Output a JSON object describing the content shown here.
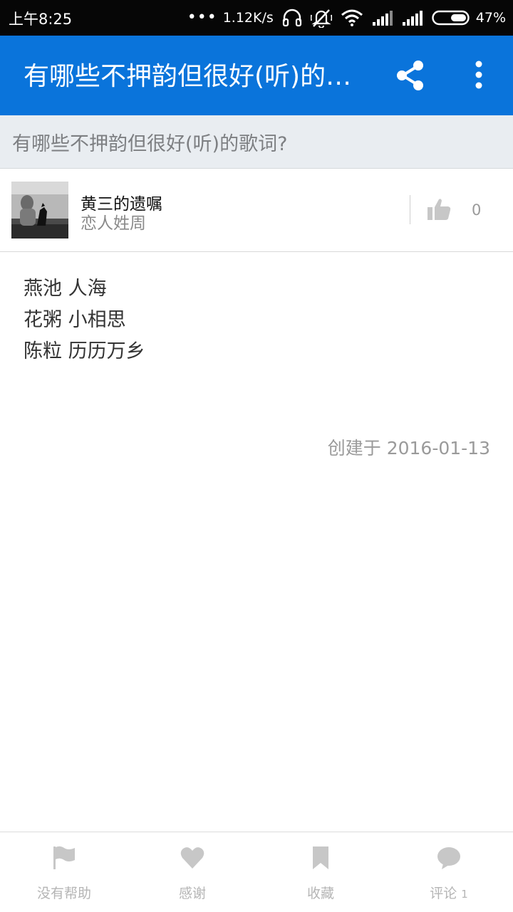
{
  "status_bar": {
    "time": "上午8:25",
    "network_speed": "1.12K/s",
    "battery_percent": "47%",
    "icons": [
      "more-dots-icon",
      "headset-icon",
      "mute-icon",
      "wifi-icon",
      "signal-icon",
      "signal-icon",
      "battery-icon"
    ]
  },
  "app_bar": {
    "title": "有哪些不押韵但很好(听)的歌词?",
    "actions": [
      "share-icon",
      "more-vert-icon"
    ],
    "accent": "#0a74db"
  },
  "question": {
    "title": "有哪些不押韵但很好(听)的歌词?"
  },
  "author": {
    "name": "黄三的遗嘱",
    "bio": "恋人姓周",
    "vote_count": "0"
  },
  "answer": {
    "lines": [
      "燕池 人海",
      "花粥 小相思",
      "陈粒 历历万乡"
    ],
    "created": "创建于 2016-01-13"
  },
  "bottom_bar": {
    "tabs": [
      {
        "label": "没有帮助",
        "icon": "flag-icon"
      },
      {
        "label": "感谢",
        "icon": "heart-icon"
      },
      {
        "label": "收藏",
        "icon": "bookmark-icon"
      },
      {
        "label": "评论",
        "icon": "comment-icon",
        "count": "1"
      }
    ]
  }
}
